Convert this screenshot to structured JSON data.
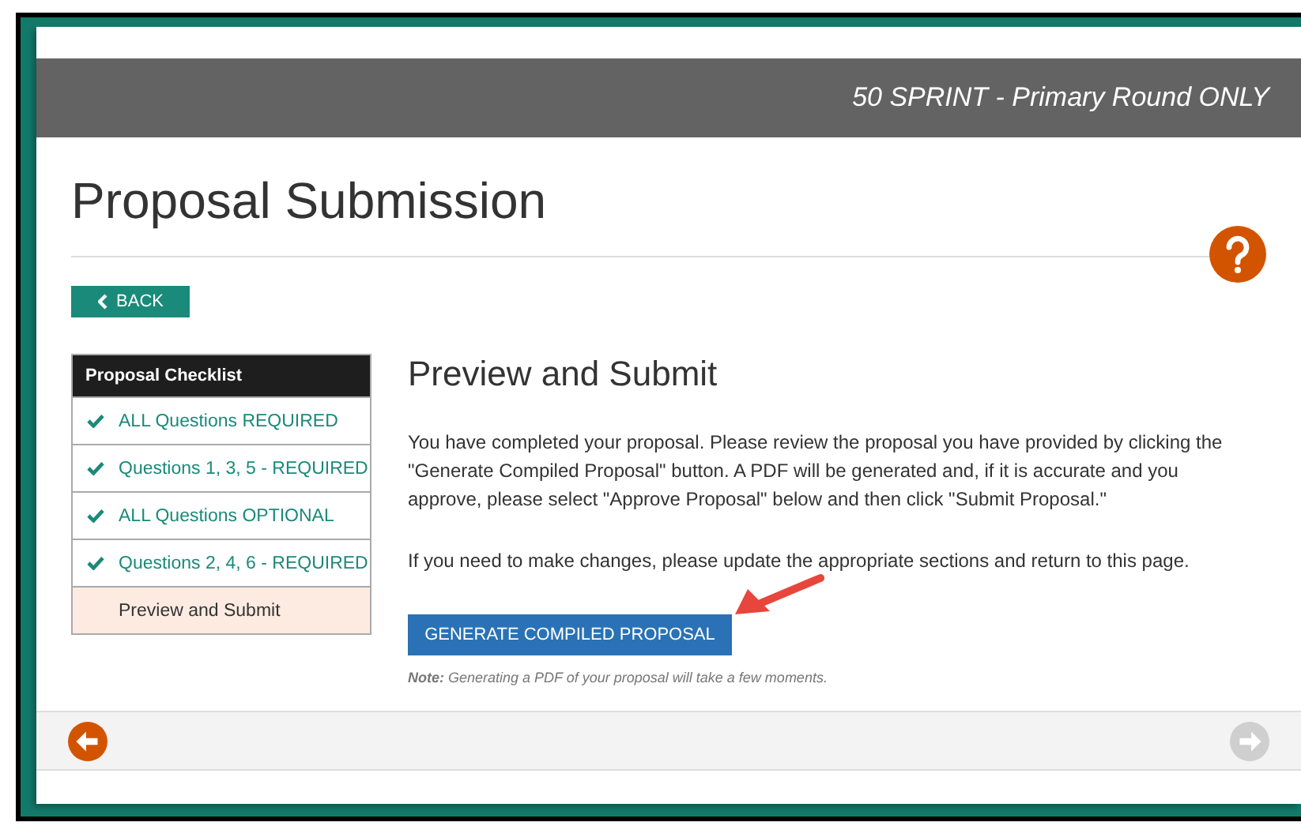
{
  "header": {
    "program": "50 SPRINT - Primary Round ONLY"
  },
  "page": {
    "title": "Proposal Submission",
    "back_button": "BACK"
  },
  "checklist": {
    "title": "Proposal Checklist",
    "items": [
      {
        "label": "ALL Questions REQUIRED",
        "done": true,
        "selected": false
      },
      {
        "label": "Questions 1, 3, 5 - REQUIRED",
        "done": true,
        "selected": false
      },
      {
        "label": "ALL Questions OPTIONAL",
        "done": true,
        "selected": false
      },
      {
        "label": "Questions 2, 4, 6 - REQUIRED",
        "done": true,
        "selected": false
      },
      {
        "label": "Preview and Submit",
        "done": false,
        "selected": true
      }
    ]
  },
  "content": {
    "heading": "Preview and Submit",
    "paragraphs": [
      "You have completed your proposal. Please review the proposal you have provided by clicking the \"Generate Compiled Proposal\" button. A PDF will be generated and, if it is accurate and you approve, please select \"Approve Proposal\" below and then click \"Submit Proposal.\"",
      "If you need to make changes, please update the appropriate sections and return to this page."
    ],
    "button": "GENERATE COMPILED PROPOSAL",
    "note": "**Note:** Generating a PDF of your proposal will take a few moments."
  },
  "footer": {
    "previous": {
      "disabled": false
    },
    "next": {
      "disabled": true
    }
  }
}
